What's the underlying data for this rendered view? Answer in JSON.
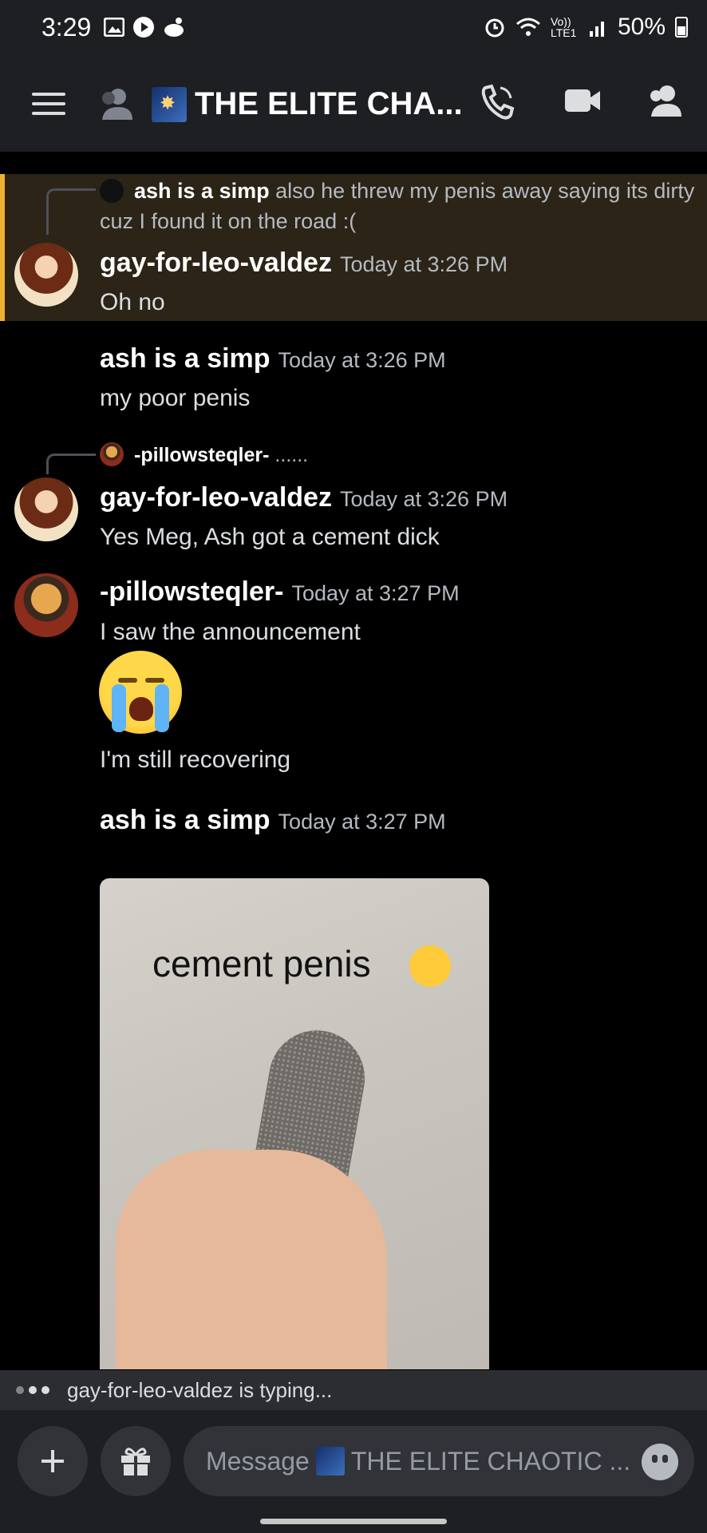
{
  "status_bar": {
    "time": "3:29",
    "network": "Vo)) LTE1",
    "battery": "50%",
    "icons_left": [
      "gallery-icon",
      "play-icon",
      "notification-icon"
    ],
    "icons_right": [
      "alarm-icon",
      "wifi-icon",
      "signal-icon",
      "battery-icon"
    ]
  },
  "header": {
    "channel_title": "THE ELITE CHA...",
    "icons": [
      "menu-icon",
      "friends-icon",
      "call-icon",
      "video-icon",
      "members-icon"
    ]
  },
  "messages": [
    {
      "reply_to": {
        "author": "ash is a simp",
        "text": "also he threw my penis away saying its dirty",
        "text_cont": "cuz I found it on the road :("
      },
      "author": "gay-for-leo-valdez",
      "timestamp": "Today at 3:26 PM",
      "content": "Oh no",
      "highlighted": true
    },
    {
      "author": "ash is a simp",
      "timestamp": "Today at 3:26 PM",
      "content": "my poor penis"
    },
    {
      "reply_to": {
        "author": "-pillowsteqler-",
        "text": "......"
      },
      "author": "gay-for-leo-valdez",
      "timestamp": "Today at 3:26 PM",
      "content": "Yes Meg, Ash got a cement dick"
    },
    {
      "author": "-pillowsteqler-",
      "timestamp": "Today at 3:27 PM",
      "content": "I saw the announcement",
      "emoji": "loudly-crying-face",
      "content_after": "I'm still recovering"
    },
    {
      "author": "ash is a simp",
      "timestamp": "Today at 3:27 PM",
      "image_caption": "cement penis"
    }
  ],
  "typing": {
    "text": "gay-for-leo-valdez is typing..."
  },
  "composer": {
    "placeholder_prefix": "Message",
    "placeholder_channel": "THE ELITE CHAOTIC ..."
  },
  "colors": {
    "highlight_bar": "#f0b232",
    "highlight_bg": "#2b2417",
    "bg": "#000000",
    "header_bg": "#1e1f22"
  }
}
